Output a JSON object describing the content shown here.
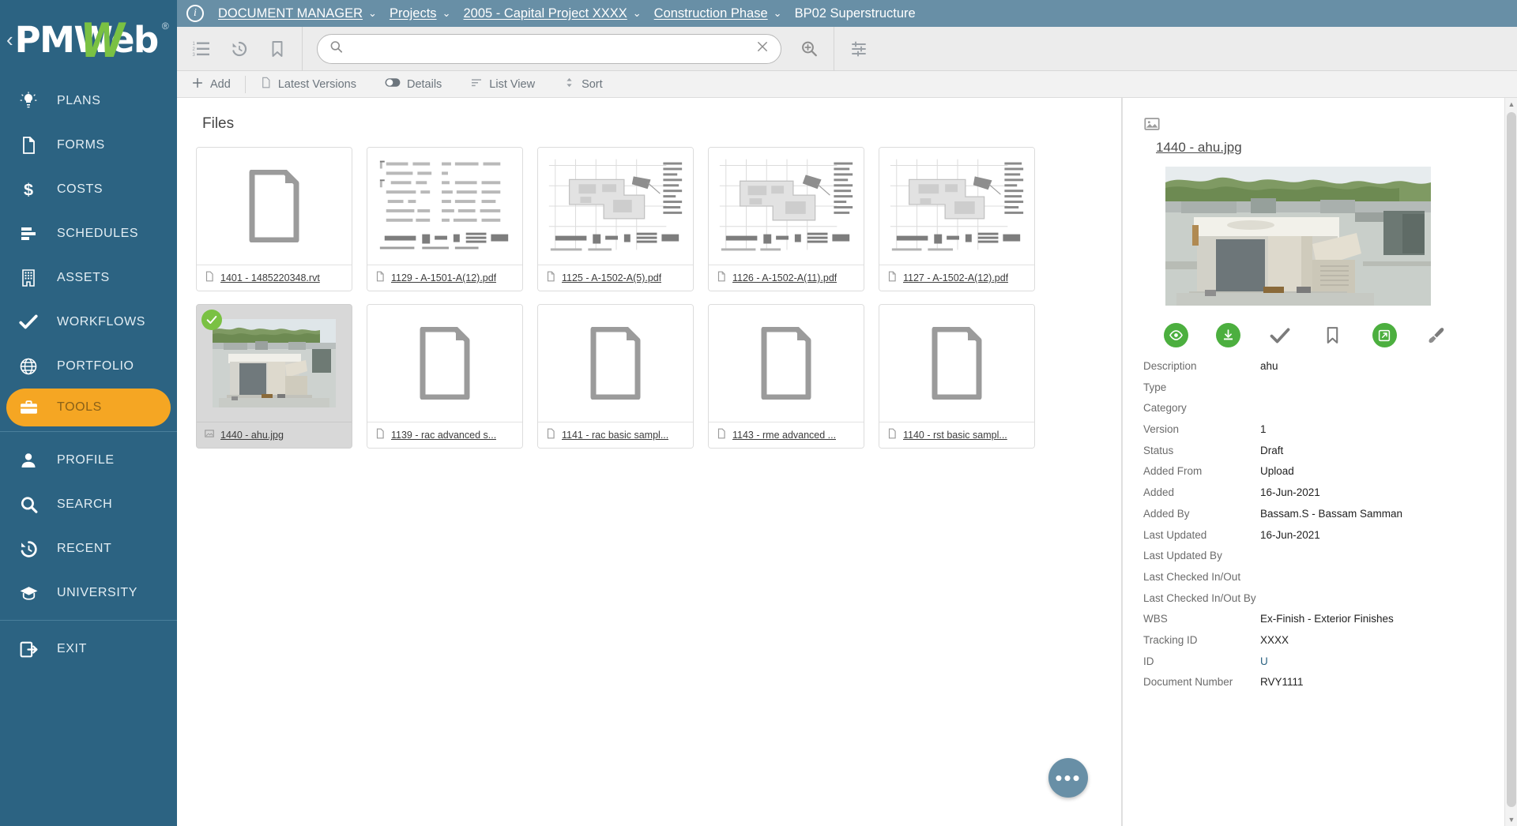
{
  "brand": {
    "name": "PMWeb",
    "registered": "®",
    "collapse": "‹",
    "accent": "#f5a623",
    "primary": "#2c6382",
    "green": "#7ac143"
  },
  "sidebar": {
    "items": [
      {
        "label": "PLANS",
        "icon": "lightbulb-icon",
        "active": false
      },
      {
        "label": "FORMS",
        "icon": "document-icon",
        "active": false
      },
      {
        "label": "COSTS",
        "icon": "dollar-icon",
        "active": false
      },
      {
        "label": "SCHEDULES",
        "icon": "schedule-bars-icon",
        "active": false
      },
      {
        "label": "ASSETS",
        "icon": "building-icon",
        "active": false
      },
      {
        "label": "WORKFLOWS",
        "icon": "check-icon",
        "active": false
      },
      {
        "label": "PORTFOLIO",
        "icon": "globe-icon",
        "active": false
      },
      {
        "label": "TOOLS",
        "icon": "toolbox-icon",
        "active": true
      }
    ],
    "items2": [
      {
        "label": "PROFILE",
        "icon": "user-icon"
      },
      {
        "label": "SEARCH",
        "icon": "search-icon"
      },
      {
        "label": "RECENT",
        "icon": "history-icon"
      },
      {
        "label": "UNIVERSITY",
        "icon": "graduation-icon"
      }
    ],
    "exit": {
      "label": "EXIT",
      "icon": "exit-icon"
    }
  },
  "topbar": {
    "info_icon": "i",
    "breadcrumbs": [
      {
        "label": "DOCUMENT MANAGER",
        "caret": "⌄",
        "is_last": false
      },
      {
        "label": "Projects",
        "caret": "⌄",
        "is_last": false
      },
      {
        "label": "2005 - Capital Project XXXX",
        "caret": "⌄",
        "is_last": false
      },
      {
        "label": "Construction Phase",
        "caret": "⌄",
        "is_last": false
      },
      {
        "label": "BP02 Superstructure",
        "caret": "",
        "is_last": true
      }
    ]
  },
  "toolbar": {
    "icons": [
      {
        "name": "numbered-list-icon"
      },
      {
        "name": "history-icon"
      },
      {
        "name": "bookmark-icon"
      }
    ],
    "search": {
      "value": "",
      "placeholder": "",
      "search_icon": "search-icon",
      "clear_icon": "close-icon"
    },
    "zoom_icon": "zoom-search-icon",
    "filter_icon": "filter-sliders-icon"
  },
  "subtoolbar": {
    "buttons": [
      {
        "label": "Add",
        "icon": "plus-icon"
      },
      {
        "label": "Latest Versions",
        "icon": "document-icon"
      },
      {
        "label": "Details",
        "icon": "toggle-on-icon"
      },
      {
        "label": "List View",
        "icon": "list-lines-icon"
      },
      {
        "label": "Sort",
        "icon": "sort-arrows-icon"
      }
    ]
  },
  "files": {
    "title": "Files",
    "fab_label": "•••",
    "items": [
      {
        "name": "1401 - 1485220348.rvt",
        "icon": "document-icon",
        "thumb": "blank-doc",
        "selected": false
      },
      {
        "name": "1129 - A-1501-A(12).pdf",
        "icon": "pdf-icon",
        "thumb": "schedule-drawing",
        "selected": false
      },
      {
        "name": "1125 - A-1502-A(5).pdf",
        "icon": "pdf-icon",
        "thumb": "floorplan-drawing",
        "selected": false
      },
      {
        "name": "1126 - A-1502-A(11).pdf",
        "icon": "pdf-icon",
        "thumb": "floorplan-drawing",
        "selected": false
      },
      {
        "name": "1127 - A-1502-A(12).pdf",
        "icon": "pdf-icon",
        "thumb": "floorplan-drawing",
        "selected": false
      },
      {
        "name": "1440 - ahu.jpg",
        "icon": "image-icon",
        "thumb": "photo-ahu",
        "selected": true
      },
      {
        "name": "1139 - rac advanced  s...",
        "icon": "document-icon",
        "thumb": "blank-doc",
        "selected": false
      },
      {
        "name": "1141 - rac basic  sampl...",
        "icon": "document-icon",
        "thumb": "blank-doc",
        "selected": false
      },
      {
        "name": "1143 - rme advanced ...",
        "icon": "document-icon",
        "thumb": "blank-doc",
        "selected": false
      },
      {
        "name": "1140 - rst basic sampl...",
        "icon": "document-icon",
        "thumb": "blank-doc",
        "selected": false
      }
    ]
  },
  "details": {
    "header_icon": "image-icon",
    "filename": "1440 - ahu.jpg",
    "preview_alt": "photo-ahu",
    "actions": [
      {
        "name": "view-button",
        "icon": "eye-icon",
        "style": "green-circle"
      },
      {
        "name": "download-button",
        "icon": "download-icon",
        "style": "green-circle"
      },
      {
        "name": "approve-button",
        "icon": "check-icon",
        "style": "gray"
      },
      {
        "name": "bookmark-button",
        "icon": "bookmark-icon",
        "style": "gray"
      },
      {
        "name": "open-external-button",
        "icon": "external-link-icon",
        "style": "green-circle"
      },
      {
        "name": "markup-button",
        "icon": "brush-icon",
        "style": "gray"
      }
    ],
    "fields": [
      {
        "label": "Description",
        "value": "ahu",
        "link": false
      },
      {
        "label": "Type",
        "value": "",
        "link": false
      },
      {
        "label": "Category",
        "value": "",
        "link": false
      },
      {
        "label": "Version",
        "value": "1",
        "link": false
      },
      {
        "label": "Status",
        "value": "Draft",
        "link": false
      },
      {
        "label": "Added From",
        "value": "Upload",
        "link": false
      },
      {
        "label": "Added",
        "value": "16-Jun-2021",
        "link": false
      },
      {
        "label": "Added By",
        "value": "Bassam.S - Bassam Samman",
        "link": false
      },
      {
        "label": "Last Updated",
        "value": "16-Jun-2021",
        "link": false
      },
      {
        "label": "Last Updated By",
        "value": "",
        "link": false
      },
      {
        "label": "Last Checked In/Out",
        "value": "",
        "link": false
      },
      {
        "label": "Last Checked In/Out By",
        "value": "",
        "link": false
      },
      {
        "label": "WBS",
        "value": "Ex-Finish - Exterior Finishes",
        "link": false
      },
      {
        "label": "Tracking ID",
        "value": "XXXX",
        "link": false
      },
      {
        "label": "ID",
        "value": "U",
        "link": true
      },
      {
        "label": "Document Number",
        "value": "RVY1111",
        "link": false
      }
    ],
    "scroll_up": "▲",
    "scroll_down": "▼"
  }
}
